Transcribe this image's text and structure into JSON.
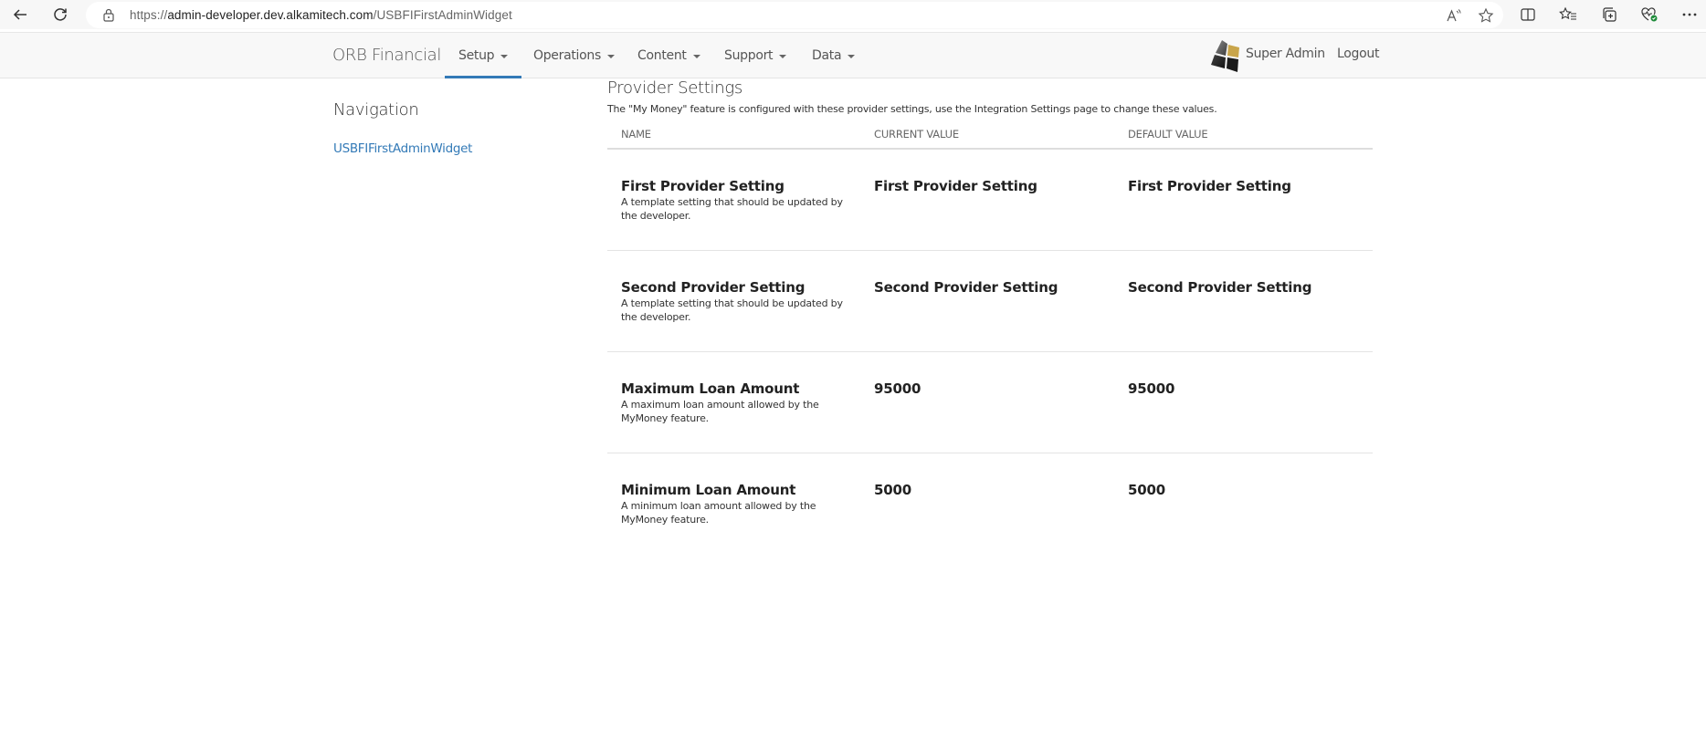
{
  "browser": {
    "url_prefix": "https://",
    "url_host": "admin-developer.dev.alkamitech.com",
    "url_path": "/USBFIFirstAdminWidget",
    "icons": {
      "back": "back-arrow-icon",
      "refresh": "refresh-icon",
      "lock": "lock-icon",
      "read_aloud": "read-aloud-icon",
      "favorite": "star-icon",
      "split_screen": "split-screen-icon",
      "favorites": "favorites-list-icon",
      "collections": "collections-icon",
      "browser_essentials": "heart-pulse-icon",
      "more": "more-icon"
    }
  },
  "navbar": {
    "brand": "ORB Financial",
    "menus": [
      {
        "label": "Setup",
        "active": true
      },
      {
        "label": "Operations",
        "active": false
      },
      {
        "label": "Content",
        "active": false
      },
      {
        "label": "Support",
        "active": false
      },
      {
        "label": "Data",
        "active": false
      }
    ],
    "user": "Super Admin",
    "logout": "Logout",
    "accent_color": "#337ab7"
  },
  "sidebar": {
    "title": "Navigation",
    "links": [
      {
        "label": "USBFIFirstAdminWidget"
      }
    ]
  },
  "main": {
    "title": "Provider Settings",
    "description": "The \"My Money\" feature is configured with these provider settings, use the Integration Settings page to change these values.",
    "columns": [
      "NAME",
      "CURRENT VALUE",
      "DEFAULT VALUE"
    ],
    "rows": [
      {
        "name": "First Provider Setting",
        "description": "A template setting that should be updated by the developer.",
        "current": "First Provider Setting",
        "default": "First Provider Setting"
      },
      {
        "name": "Second Provider Setting",
        "description": "A template setting that should be updated by the developer.",
        "current": "Second Provider Setting",
        "default": "Second Provider Setting"
      },
      {
        "name": "Maximum Loan Amount",
        "description": "A maximum loan amount allowed by the MyMoney feature.",
        "current": "95000",
        "default": "95000"
      },
      {
        "name": "Minimum Loan Amount",
        "description": "A minimum loan amount allowed by the MyMoney feature.",
        "current": "5000",
        "default": "5000"
      }
    ]
  }
}
